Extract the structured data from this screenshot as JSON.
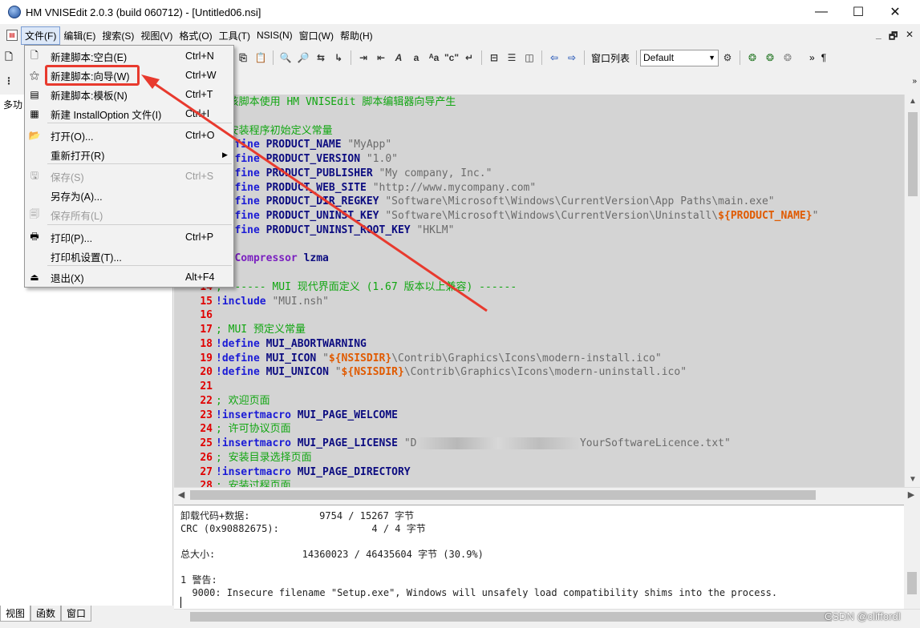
{
  "window": {
    "title": "HM VNISEdit 2.0.3 (build 060712) - [Untitled06.nsi]",
    "minimize": "—",
    "maximize": "☐",
    "close": "✕"
  },
  "menubar": {
    "items": [
      "文件(F)",
      "编辑(E)",
      "搜索(S)",
      "视图(V)",
      "格式(O)",
      "工具(T)",
      "NSIS(N)",
      "窗口(W)",
      "帮助(H)"
    ],
    "mdi_minimize": "_",
    "mdi_restore": "🗗",
    "mdi_close": "✕"
  },
  "toolbar": {
    "window_list_label": "窗口列表",
    "style_combo_value": "Default",
    "more": "»",
    "pilcrow": "¶"
  },
  "left_panel": {
    "caption": "多功",
    "tabs": [
      "视图",
      "函数",
      "窗口"
    ]
  },
  "file_menu": {
    "items": [
      {
        "label": "新建脚本:空白(E)",
        "shortcut": "Ctrl+N",
        "icon": "new-blank-icon",
        "glyph": "🗋",
        "disabled": false
      },
      {
        "label": "新建脚本:向导(W)",
        "shortcut": "Ctrl+W",
        "icon": "wizard-icon",
        "glyph": "⚝",
        "disabled": false
      },
      {
        "label": "新建脚本:模板(N)",
        "shortcut": "Ctrl+T",
        "icon": "template-icon",
        "glyph": "▤",
        "disabled": false
      },
      {
        "label": "新建 InstallOption 文件(I)",
        "shortcut": "Ctrl+I",
        "icon": "installoption-icon",
        "glyph": "▦",
        "disabled": false
      },
      {
        "label": "打开(O)...",
        "shortcut": "Ctrl+O",
        "icon": "open-folder-icon",
        "glyph": "📂",
        "disabled": false
      },
      {
        "label": "重新打开(R)",
        "shortcut": "",
        "icon": "",
        "glyph": "",
        "disabled": false,
        "submenu": true
      },
      {
        "label": "保存(S)",
        "shortcut": "Ctrl+S",
        "icon": "save-icon",
        "glyph": "🖫",
        "disabled": true
      },
      {
        "label": "另存为(A)...",
        "shortcut": "",
        "icon": "",
        "glyph": "",
        "disabled": false
      },
      {
        "label": "保存所有(L)",
        "shortcut": "",
        "icon": "save-all-icon",
        "glyph": "🗐",
        "disabled": true
      },
      {
        "label": "打印(P)...",
        "shortcut": "Ctrl+P",
        "icon": "print-icon",
        "glyph": "🖶",
        "disabled": false
      },
      {
        "label": "打印机设置(T)...",
        "shortcut": "",
        "icon": "",
        "glyph": "",
        "disabled": false
      },
      {
        "label": "退出(X)",
        "shortcut": "Alt+F4",
        "icon": "exit-icon",
        "glyph": "⏏",
        "disabled": false
      }
    ]
  },
  "editor": {
    "lines": [
      {
        "n": "",
        "parts": [
          {
            "t": "; 该脚本使用 HM VNISEdit 脚本编辑器向导产生",
            "c": "cmt"
          }
        ]
      },
      {
        "n": "",
        "parts": []
      },
      {
        "n": "",
        "parts": [
          {
            "t": "; 安装程序初始定义常量",
            "c": "cmt"
          }
        ]
      },
      {
        "n": "",
        "parts": [
          {
            "t": "!define",
            "c": "kw"
          },
          {
            "t": " PRODUCT_NAME ",
            "c": "id"
          },
          {
            "t": "\"MyApp\"",
            "c": "str"
          }
        ]
      },
      {
        "n": "",
        "parts": [
          {
            "t": "!define",
            "c": "kw"
          },
          {
            "t": " PRODUCT_VERSION ",
            "c": "id"
          },
          {
            "t": "\"1.0\"",
            "c": "str"
          }
        ]
      },
      {
        "n": "",
        "parts": [
          {
            "t": "!define",
            "c": "kw"
          },
          {
            "t": " PRODUCT_PUBLISHER ",
            "c": "id"
          },
          {
            "t": "\"My company, Inc.\"",
            "c": "str"
          }
        ]
      },
      {
        "n": "",
        "parts": [
          {
            "t": "!define",
            "c": "kw"
          },
          {
            "t": " PRODUCT_WEB_SITE ",
            "c": "id"
          },
          {
            "t": "\"http://www.mycompany.com\"",
            "c": "str"
          }
        ]
      },
      {
        "n": "",
        "parts": [
          {
            "t": "!define",
            "c": "kw"
          },
          {
            "t": " PRODUCT_DIR_REGKEY ",
            "c": "id"
          },
          {
            "t": "\"Software\\Microsoft\\Windows\\CurrentVersion\\App Paths\\main.exe\"",
            "c": "str"
          }
        ]
      },
      {
        "n": "",
        "parts": [
          {
            "t": "!define",
            "c": "kw"
          },
          {
            "t": " PRODUCT_UNINST_KEY ",
            "c": "id"
          },
          {
            "t": "\"Software\\Microsoft\\Windows\\CurrentVersion\\Uninstall\\",
            "c": "str"
          },
          {
            "t": "${PRODUCT_NAME}",
            "c": "var"
          },
          {
            "t": "\"",
            "c": "str"
          }
        ]
      },
      {
        "n": "",
        "parts": [
          {
            "t": "!define",
            "c": "kw"
          },
          {
            "t": " PRODUCT_UNINST_ROOT_KEY ",
            "c": "id"
          },
          {
            "t": "\"HKLM\"",
            "c": "str"
          }
        ]
      },
      {
        "n": "",
        "parts": []
      },
      {
        "n": "",
        "parts": [
          {
            "t": "SetCompressor",
            "c": "purple"
          },
          {
            "t": " lzma",
            "c": "id"
          }
        ]
      },
      {
        "n": "",
        "parts": []
      },
      {
        "n": "14",
        "parts": [
          {
            "t": "; ------ MUI 现代界面定义 (1.67 版本以上兼容) ------",
            "c": "cmt"
          }
        ]
      },
      {
        "n": "15",
        "parts": [
          {
            "t": "!include",
            "c": "kw"
          },
          {
            "t": " ",
            "c": "id"
          },
          {
            "t": "\"MUI.nsh\"",
            "c": "str"
          }
        ]
      },
      {
        "n": "16",
        "parts": []
      },
      {
        "n": "17",
        "parts": [
          {
            "t": "; MUI 预定义常量",
            "c": "cmt"
          }
        ]
      },
      {
        "n": "18",
        "parts": [
          {
            "t": "!define",
            "c": "kw"
          },
          {
            "t": " MUI_ABORTWARNING",
            "c": "id"
          }
        ]
      },
      {
        "n": "19",
        "parts": [
          {
            "t": "!define",
            "c": "kw"
          },
          {
            "t": " MUI_ICON ",
            "c": "id"
          },
          {
            "t": "\"",
            "c": "str"
          },
          {
            "t": "${NSISDIR}",
            "c": "var"
          },
          {
            "t": "\\Contrib\\Graphics\\Icons\\modern-install.ico\"",
            "c": "str"
          }
        ]
      },
      {
        "n": "20",
        "parts": [
          {
            "t": "!define",
            "c": "kw"
          },
          {
            "t": " MUI_UNICON ",
            "c": "id"
          },
          {
            "t": "\"",
            "c": "str"
          },
          {
            "t": "${NSISDIR}",
            "c": "var"
          },
          {
            "t": "\\Contrib\\Graphics\\Icons\\modern-uninstall.ico\"",
            "c": "str"
          }
        ]
      },
      {
        "n": "21",
        "parts": []
      },
      {
        "n": "22",
        "parts": [
          {
            "t": "; 欢迎页面",
            "c": "cmt"
          }
        ]
      },
      {
        "n": "23",
        "parts": [
          {
            "t": "!insertmacro",
            "c": "kw"
          },
          {
            "t": " MUI_PAGE_WELCOME",
            "c": "id"
          }
        ]
      },
      {
        "n": "24",
        "parts": [
          {
            "t": "; 许可协议页面",
            "c": "cmt"
          }
        ]
      },
      {
        "n": "25",
        "parts": [
          {
            "t": "!insertmacro",
            "c": "kw"
          },
          {
            "t": " MUI_PAGE_LICENSE ",
            "c": "id"
          },
          {
            "t": "\"D",
            "c": "str"
          },
          {
            "t": "                          ",
            "c": "blur"
          },
          {
            "t": "YourSoftwareLicence.txt\"",
            "c": "str"
          }
        ]
      },
      {
        "n": "26",
        "parts": [
          {
            "t": "; 安装目录选择页面",
            "c": "cmt"
          }
        ]
      },
      {
        "n": "27",
        "parts": [
          {
            "t": "!insertmacro",
            "c": "kw"
          },
          {
            "t": " MUI_PAGE_DIRECTORY",
            "c": "id"
          }
        ]
      },
      {
        "n": "28",
        "parts": [
          {
            "t": "; 安装过程页面",
            "c": "cmt"
          }
        ]
      }
    ]
  },
  "output": {
    "lines": [
      "卸载代码+数据:            9754 / 15267 字节",
      "CRC (0x90882675):                4 / 4 字节",
      "",
      "总大小:               14360023 / 46435604 字节 (30.9%)",
      "",
      "1 警告:",
      "  9000: Insecure filename \"Setup.exe\", Windows will unsafely load compatibility shims into the process."
    ]
  },
  "watermark": "CSDN @cliffordl",
  "colors": {
    "highlight": "#e83a2e",
    "arrow": "#e83a2e"
  }
}
